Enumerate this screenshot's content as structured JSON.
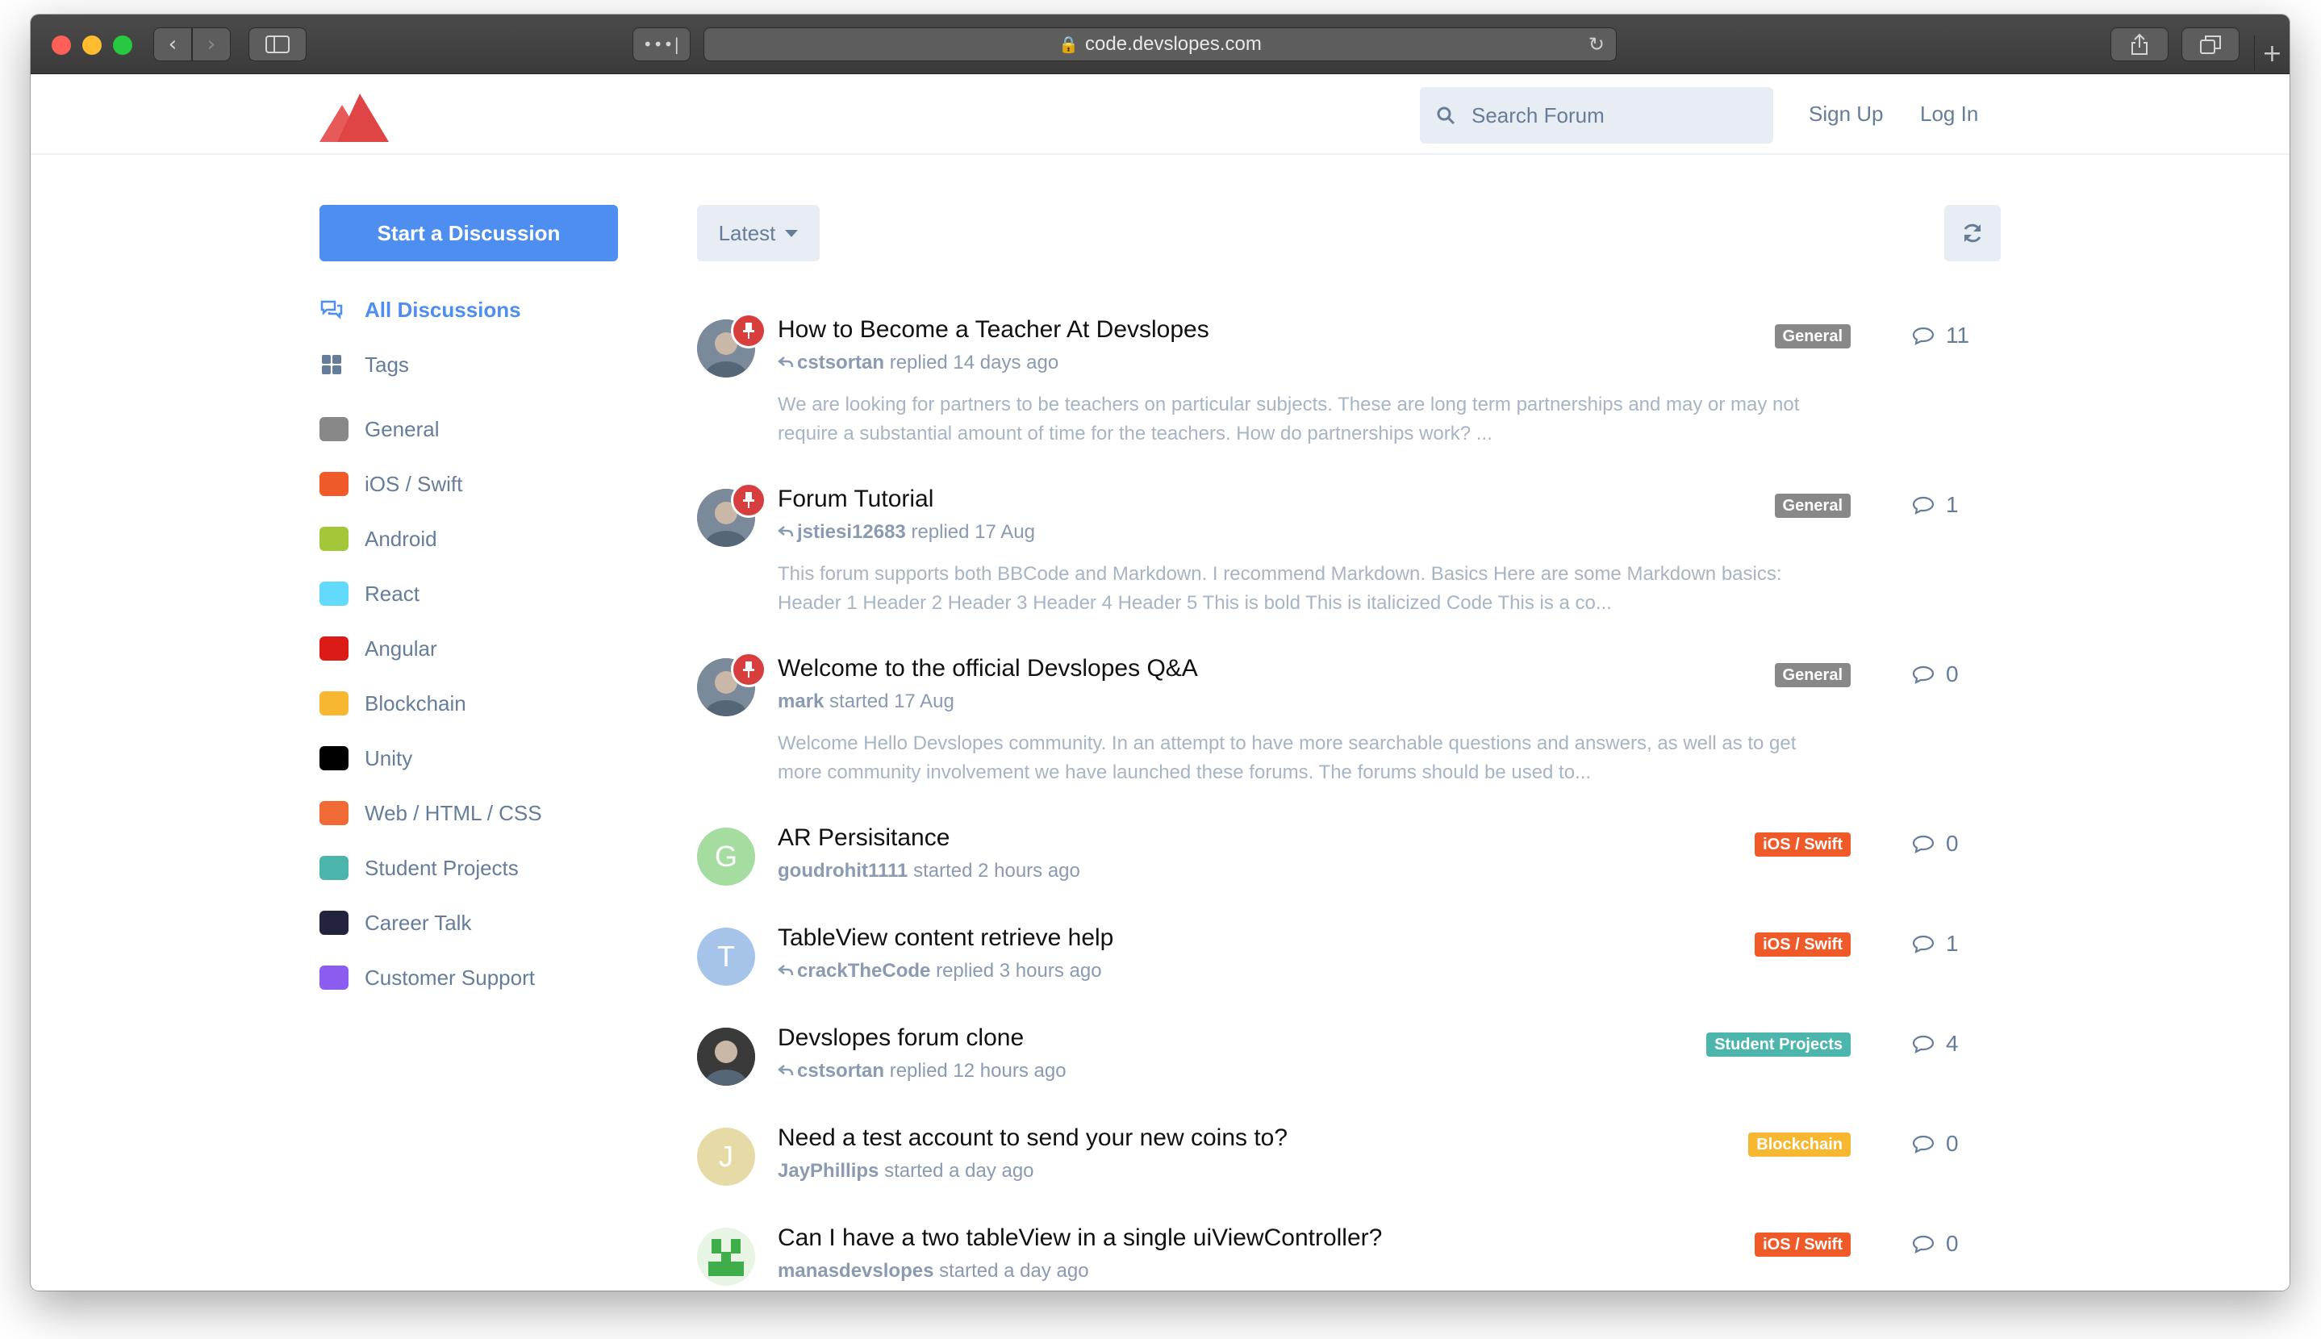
{
  "browser": {
    "url": "code.devslopes.com"
  },
  "header": {
    "search_placeholder": "Search Forum",
    "signup": "Sign Up",
    "login": "Log In"
  },
  "sidebar": {
    "start_button": "Start a Discussion",
    "nav": [
      {
        "label": "All Discussions",
        "icon": "chat-bubbles-icon",
        "active": true
      },
      {
        "label": "Tags",
        "icon": "grid-icon",
        "active": false
      }
    ],
    "tags": [
      {
        "label": "General",
        "color": "#888888"
      },
      {
        "label": "iOS / Swift",
        "color": "#f05a28"
      },
      {
        "label": "Android",
        "color": "#a4c639"
      },
      {
        "label": "React",
        "color": "#61dafb"
      },
      {
        "label": "Angular",
        "color": "#dd1b16"
      },
      {
        "label": "Blockchain",
        "color": "#f7b731"
      },
      {
        "label": "Unity",
        "color": "#000000"
      },
      {
        "label": "Web / HTML / CSS",
        "color": "#f06a35"
      },
      {
        "label": "Student Projects",
        "color": "#4db6ac"
      },
      {
        "label": "Career Talk",
        "color": "#23233e"
      },
      {
        "label": "Customer Support",
        "color": "#8c5cf0"
      }
    ]
  },
  "toolbar": {
    "sort_label": "Latest"
  },
  "discussions": [
    {
      "title": "How to Become a Teacher At Devslopes",
      "user": "cstsortan",
      "action": "replied 14 days ago",
      "replied": true,
      "pinned": true,
      "avatar_letter": "",
      "avatar_color": "#7a8a9a",
      "excerpt": "We are looking for partners to be teachers on particular subjects. These are long term partnerships and may or may not require a substantial amount of time for the teachers. How do partnerships work? ...",
      "tag": "General",
      "tag_color": "#888888",
      "count": "11"
    },
    {
      "title": "Forum Tutorial",
      "user": "jstiesi12683",
      "action": "replied 17 Aug",
      "replied": true,
      "pinned": true,
      "avatar_letter": "",
      "avatar_color": "#7a8a9a",
      "excerpt": "This forum supports both BBCode and Markdown. I recommend Markdown. Basics Here are some Markdown basics: Header 1 Header 2 Header 3 Header 4 Header 5 This is bold This is italicized Code This is a co...",
      "tag": "General",
      "tag_color": "#888888",
      "count": "1"
    },
    {
      "title": "Welcome to the official Devslopes Q&A",
      "user": "mark",
      "action": "started 17 Aug",
      "replied": false,
      "pinned": true,
      "avatar_letter": "",
      "avatar_color": "#7a8a9a",
      "excerpt": "Welcome Hello Devslopes community. In an attempt to have more searchable questions and answers, as well as to get more community involvement we have launched these forums. The forums should be used to...",
      "tag": "General",
      "tag_color": "#888888",
      "count": "0"
    },
    {
      "title": "AR Persisitance",
      "user": "goudrohit1111",
      "action": "started 2 hours ago",
      "replied": false,
      "pinned": false,
      "avatar_letter": "G",
      "avatar_color": "#a5dca0",
      "excerpt": "",
      "tag": "iOS / Swift",
      "tag_color": "#f05a28",
      "count": "0"
    },
    {
      "title": "TableView content retrieve help",
      "user": "crackTheCode",
      "action": "replied 3 hours ago",
      "replied": true,
      "pinned": false,
      "avatar_letter": "T",
      "avatar_color": "#a6c4ea",
      "excerpt": "",
      "tag": "iOS / Swift",
      "tag_color": "#f05a28",
      "count": "1"
    },
    {
      "title": "Devslopes forum clone",
      "user": "cstsortan",
      "action": "replied 12 hours ago",
      "replied": true,
      "pinned": false,
      "avatar_letter": "",
      "avatar_color": "#3a3a3a",
      "excerpt": "",
      "tag": "Student Projects",
      "tag_color": "#4db6ac",
      "count": "4"
    },
    {
      "title": "Need a test account to send your new coins to?",
      "user": "JayPhillips",
      "action": "started a day ago",
      "replied": false,
      "pinned": false,
      "avatar_letter": "J",
      "avatar_color": "#e6dba6",
      "excerpt": "",
      "tag": "Blockchain",
      "tag_color": "#f7b731",
      "count": "0"
    },
    {
      "title": "Can I have a two tableView in a single uiViewController?",
      "user": "manasdevslopes",
      "action": "started a day ago",
      "replied": false,
      "pinned": false,
      "avatar_letter": "",
      "avatar_color": "#e8f4e4",
      "excerpt": "",
      "tag": "iOS / Swift",
      "tag_color": "#f05a28",
      "count": "0"
    }
  ]
}
